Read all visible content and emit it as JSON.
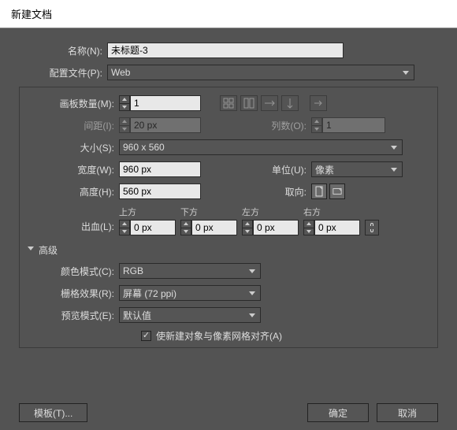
{
  "title": "新建文档",
  "name": {
    "label": "名称(N):",
    "value": "未标题-3"
  },
  "profile": {
    "label": "配置文件(P):",
    "value": "Web"
  },
  "artboards": {
    "label": "画板数量(M):",
    "value": "1"
  },
  "spacing": {
    "label": "间距(I):",
    "value": "20 px"
  },
  "columns": {
    "label": "列数(O):",
    "value": "1"
  },
  "size": {
    "label": "大小(S):",
    "value": "960 x 560"
  },
  "width": {
    "label": "宽度(W):",
    "value": "960 px"
  },
  "units": {
    "label": "单位(U):",
    "value": "像素"
  },
  "height": {
    "label": "高度(H):",
    "value": "560 px"
  },
  "orientation": {
    "label": "取向:"
  },
  "bleed": {
    "label": "出血(L):",
    "top": {
      "label": "上方",
      "value": "0 px"
    },
    "bottom": {
      "label": "下方",
      "value": "0 px"
    },
    "left": {
      "label": "左方",
      "value": "0 px"
    },
    "right": {
      "label": "右方",
      "value": "0 px"
    }
  },
  "advanced": {
    "label": "高级"
  },
  "colorMode": {
    "label": "颜色模式(C):",
    "value": "RGB"
  },
  "raster": {
    "label": "栅格效果(R):",
    "value": "屏幕 (72 ppi)"
  },
  "preview": {
    "label": "预览模式(E):",
    "value": "默认值"
  },
  "alignPixel": {
    "label": "使新建对象与像素网格对齐(A)"
  },
  "buttons": {
    "template": "模板(T)...",
    "ok": "确定",
    "cancel": "取消"
  }
}
